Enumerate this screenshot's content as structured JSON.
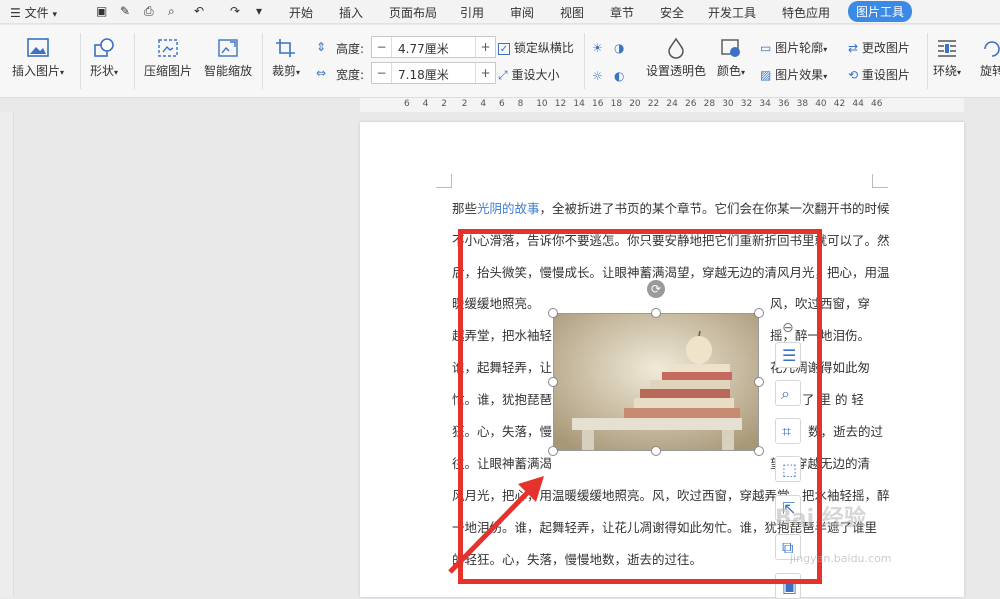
{
  "menu": {
    "label": "文件"
  },
  "tabs": [
    "开始",
    "插入",
    "页面布局",
    "引用",
    "审阅",
    "视图",
    "章节",
    "安全",
    "开发工具",
    "特色应用",
    "图片工具"
  ],
  "ribbon": {
    "insert_picture": "插入图片",
    "shape": "形状",
    "compress": "压缩图片",
    "smart_zoom": "智能缩放",
    "crop": "裁剪",
    "height_label": "高度:",
    "height_value": "4.77厘米",
    "width_label": "宽度:",
    "width_value": "7.18厘米",
    "lock_ratio": "锁定纵横比",
    "reset_size": "重设大小",
    "transparent": "设置透明色",
    "color": "颜色",
    "outline": "图片轮廓",
    "effect": "图片效果",
    "change_pic": "更改图片",
    "reset_pic": "重设图片",
    "wrap": "环绕",
    "rotate": "旋转"
  },
  "ruler_ticks": [
    "6",
    "4",
    "2",
    "2",
    "4",
    "6",
    "8",
    "10",
    "12",
    "14",
    "16",
    "18",
    "20",
    "22",
    "24",
    "26",
    "28",
    "30",
    "32",
    "34",
    "36",
    "38",
    "40",
    "42",
    "44",
    "46"
  ],
  "doc": {
    "l1_pre": "那些",
    "l1_link": "光阴的故事",
    "l1_post": "，全被折进了书页的某个章节。它们会在你某一次翻开书的时候",
    "l2": "不小心滑落，告诉你不要逃怎。你只要安静地把它们重新折回书里就可以了。然",
    "l3": "后，抬头微笑，慢慢成长。让眼神蓄满渴望，穿越无边的清风月光，把心，用温",
    "l4a": "暖缓缓地照亮。",
    "l4b": "风，吹过西窗，穿",
    "l5a": "越弄堂，把水袖轻",
    "l5b": "摇，醉一地泪伤。",
    "l6a": "谁，起舞轻弄，让",
    "l6b": "花儿凋谢得如此匆",
    "l7a": "忙。谁，犹抱琵琶",
    "l7b": "了  里  的  轻",
    "l8a": "狂。心，失落，慢",
    "l8b": "数，逝去的过",
    "l9a": "往。让眼神蓄满渴",
    "l9b": "望，穿越无边的清",
    "l10": "风月光，把心，用温暖缓缓地照亮。风，吹过西窗，穿越弄堂，把水袖轻摇，醉",
    "l11": "一地泪伤。谁，起舞轻弄，让花儿凋谢得如此匆忙。谁，犹抱琵琶半遮了谁里",
    "l12": "的轻狂。心，失落，慢慢地数，逝去的过往。"
  },
  "watermark": {
    "title": "Bai 经验",
    "url": "jingyan.baidu.com"
  },
  "colors": {
    "accent": "#3b8ae6",
    "highlight": "#e5322d",
    "link": "#3d7fd1"
  },
  "icons": [
    "menu-icon",
    "save-icon",
    "format-painter-icon",
    "print-icon",
    "preview-icon",
    "undo-icon",
    "redo-icon",
    "rotate-handle-icon",
    "layout-options-icon",
    "zoom-icon",
    "crop-icon",
    "select-icon"
  ]
}
